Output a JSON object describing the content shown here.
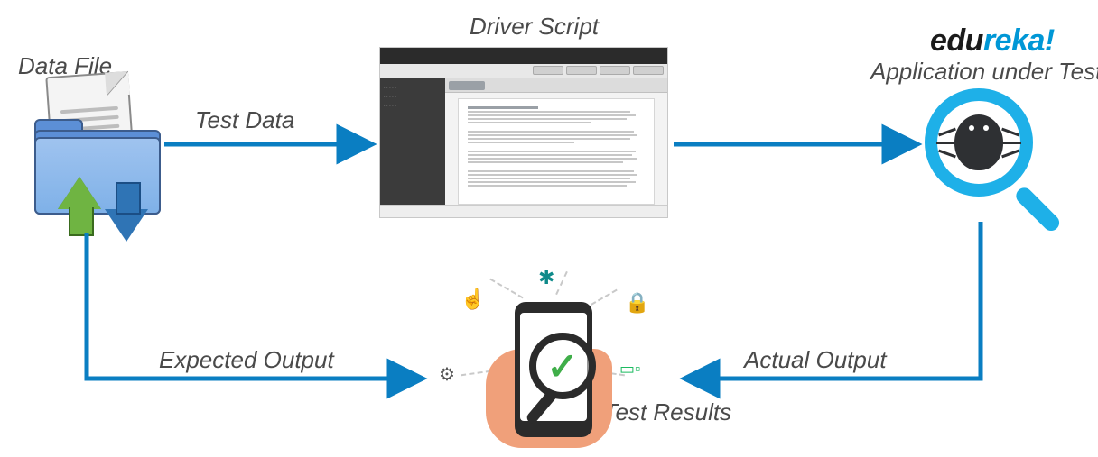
{
  "brand": {
    "part1": "edu",
    "part2": "reka",
    "bang": "!"
  },
  "nodes": {
    "data_file": "Data File",
    "driver_script": "Driver Script",
    "application_under_test": "Application under Test",
    "test_results": "Test Results"
  },
  "edges": {
    "test_data": "Test Data",
    "expected_output": "Expected Output",
    "actual_output": "Actual Output"
  },
  "flow": [
    {
      "from": "data_file",
      "to": "driver_script",
      "label_key": "test_data"
    },
    {
      "from": "driver_script",
      "to": "application_under_test",
      "label_key": null
    },
    {
      "from": "data_file",
      "to": "test_results",
      "label_key": "expected_output"
    },
    {
      "from": "application_under_test",
      "to": "test_results",
      "label_key": "actual_output"
    }
  ],
  "legend_icons": {
    "data_file": "folder-with-document-and-sync-arrows",
    "driver_script": "application-editor-screenshot",
    "application_under_test": "bug-under-magnifying-glass",
    "test_results": "phone-with-checkmark-magnifier",
    "test_results_surround": [
      "bug",
      "pointer-cursor",
      "padlock",
      "gear",
      "responsive-devices"
    ]
  },
  "colors": {
    "arrow": "#0a7ec2",
    "brand_accent": "#0097d6",
    "text": "#4a4a4a",
    "magnifier_ring": "#1eb0e8",
    "checkmark": "#3fae49"
  }
}
